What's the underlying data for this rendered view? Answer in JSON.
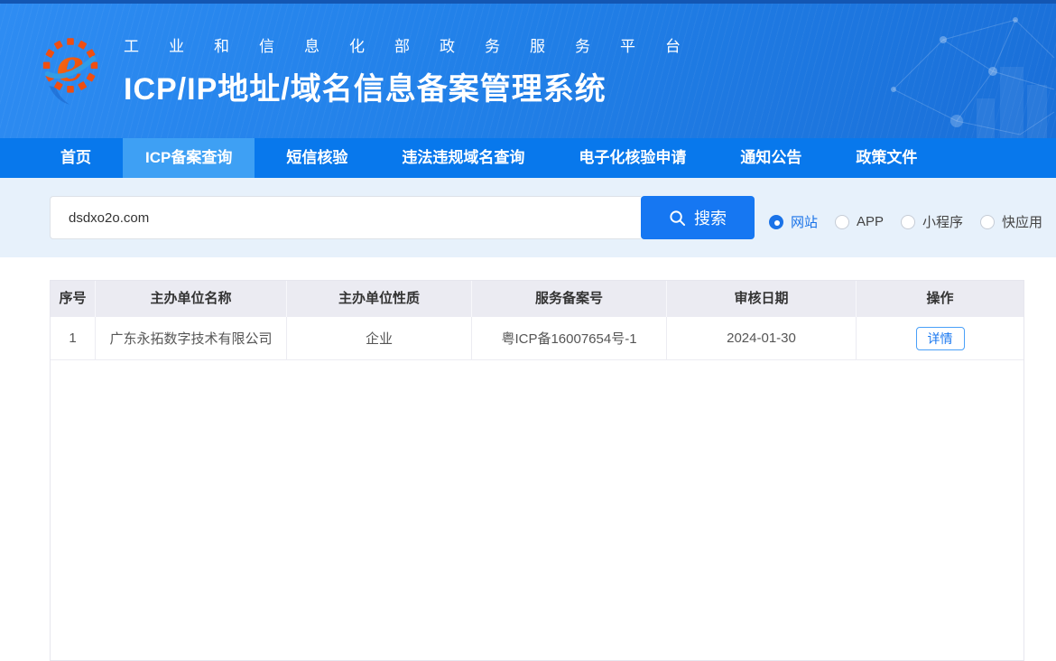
{
  "header": {
    "subtitle": "工业和信息化部政务服务平台",
    "title": "ICP/IP地址/域名信息备案管理系统"
  },
  "nav": {
    "items": [
      {
        "label": "首页",
        "active": false
      },
      {
        "label": "ICP备案查询",
        "active": true
      },
      {
        "label": "短信核验",
        "active": false
      },
      {
        "label": "违法违规域名查询",
        "active": false
      },
      {
        "label": "电子化核验申请",
        "active": false
      },
      {
        "label": "通知公告",
        "active": false
      },
      {
        "label": "政策文件",
        "active": false
      }
    ]
  },
  "search": {
    "value": "dsdxo2o.com",
    "button_label": "搜索",
    "types": [
      {
        "label": "网站",
        "selected": true
      },
      {
        "label": "APP",
        "selected": false
      },
      {
        "label": "小程序",
        "selected": false
      },
      {
        "label": "快应用",
        "selected": false
      }
    ]
  },
  "table": {
    "columns": [
      "序号",
      "主办单位名称",
      "主办单位性质",
      "服务备案号",
      "审核日期",
      "操作"
    ],
    "rows": [
      {
        "index": "1",
        "organizer_name": "广东永拓数字技术有限公司",
        "organizer_nature": "企业",
        "license_number": "粤ICP备16007654号-1",
        "review_date": "2024-01-30",
        "action_label": "详情"
      }
    ]
  },
  "icons": {
    "logo": "gear-e-swirl",
    "search": "magnifier",
    "radio_selected": "filled-dot",
    "radio_unselected": "empty-circle"
  },
  "colors": {
    "nav_bg": "#0878ec",
    "nav_active_bg": "#3ea0f4",
    "band_bg": "#e7f1fb",
    "primary_button_bg": "#1677f2",
    "link_blue": "#1a78f0",
    "table_header_bg": "#ebebf2",
    "logo_orange": "#f05313"
  }
}
